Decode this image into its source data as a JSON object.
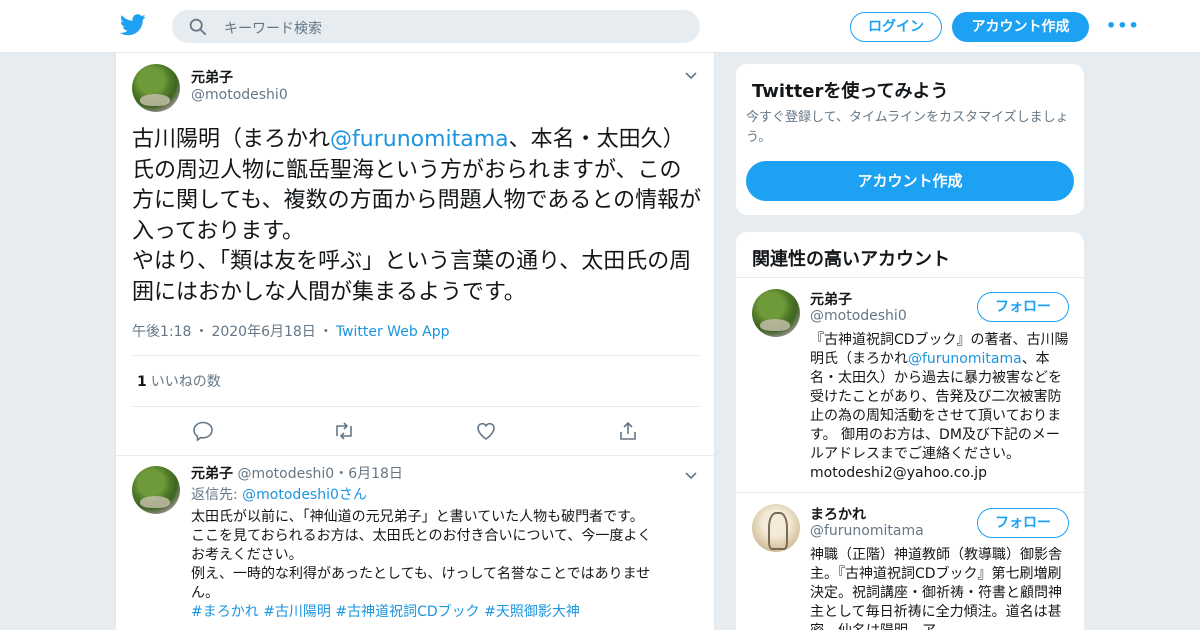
{
  "header": {
    "search_placeholder": "キーワード検索",
    "login_label": "ログイン",
    "signup_label": "アカウント作成",
    "more_label": "•••",
    "icons": [
      "twitter-logo-icon",
      "search-icon",
      "more-dots-icon"
    ],
    "accent_color": "#1da1f2"
  },
  "tweet": {
    "name": "元弟子",
    "handle": "@motodeshi0",
    "text_parts": {
      "a": "古川陽明（まろかれ",
      "mention": "@furunomitama",
      "b": "、本名・太田久）氏の周辺人物に甑岳聖海という方がおられますが、この方に関しても、複数の方面から問題人物であるとの情報が入っております。",
      "c": "やはり、「類は友を呼ぶ」という言葉の通り、太田氏の周囲にはおかしな人間が集まるようです。"
    },
    "time": "午後1:18",
    "date": "2020年6月18日",
    "source": "Twitter Web App",
    "separator": "・",
    "like_count": "1",
    "like_label": "いいねの数",
    "actions": [
      "reply-icon",
      "retweet-icon",
      "like-icon",
      "share-icon"
    ]
  },
  "reply_tweet": {
    "name": "元弟子",
    "handle": "@motodeshi0",
    "date": "6月18日",
    "separator": "・",
    "reply_to_label": "返信先:",
    "reply_to_handle": "@motodeshi0",
    "reply_to_suffix": "さん",
    "lines": [
      "太田氏が以前に、「神仙道の元兄弟子」と書いていた人物も破門者です。",
      "ここを見ておられるお方は、太田氏とのお付き合いについて、今一度よく",
      "お考えください。",
      "例え、一時的な利得があったとしても、けっして名誉なことではありませ",
      "ん。"
    ],
    "hashtags": [
      "#まろかれ",
      "#古川陽明",
      "#古神道祝詞CDブック",
      "#天照御影大神"
    ]
  },
  "signup_card": {
    "title": "Twitterを使ってみよう",
    "subtitle": "今すぐ登録して、タイムラインをカスタマイズしましょう。",
    "button_label": "アカウント作成"
  },
  "related_card": {
    "title": "関連性の高いアカウント",
    "accounts": [
      {
        "name": "元弟子",
        "handle": "@motodeshi0",
        "follow_label": "フォロー",
        "bio_a": "『古神道祝詞CDブック』の著者、古川陽明氏（まろかれ",
        "bio_mention": "@furunomitama",
        "bio_b": "、本名・太田久）から過去に暴力被害などを受けたことがあり、告発及び二次被害防止の為の周知活動をさせて頂いております。 御用のお方は、DM及び下記のメールアドレスまでご連絡ください。 motodeshi2@yahoo.co.jp"
      },
      {
        "name": "まろかれ",
        "handle": "@furunomitama",
        "follow_label": "フォロー",
        "bio": "神職（正階）神道教師（教導職）御影舎主。『古神道祝詞CDブック』第七刷増刷決定。祝詞講座・御祈祷・符書と顧問神主として毎日祈祷に全力傾注。道名は甚密。仙名は陽明。ア"
      }
    ]
  }
}
